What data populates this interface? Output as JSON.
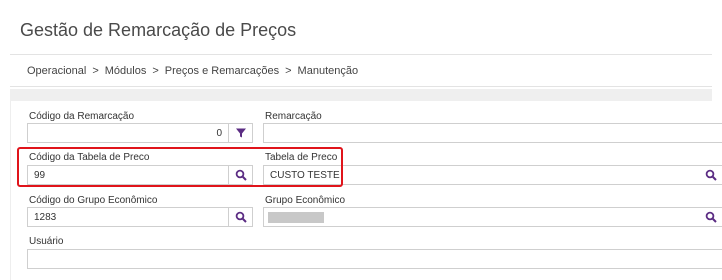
{
  "page": {
    "title": "Gestão de Remarcação de Preços"
  },
  "breadcrumb": [
    "Operacional",
    "Módulos",
    "Preços e Remarcações",
    "Manutenção"
  ],
  "breadcrumb_separator": ">",
  "form": {
    "codigo_remarcacao": {
      "label": "Código da Remarcação",
      "value": "0",
      "button_icon": "filter-icon"
    },
    "remarcacao": {
      "label": "Remarcação",
      "value": ""
    },
    "codigo_tabela_preco": {
      "label": "Código da Tabela de Preco",
      "value": "99",
      "button_icon": "search-icon"
    },
    "tabela_preco": {
      "label": "Tabela de Preco",
      "value": "CUSTO TESTE",
      "button_icon": "search-icon"
    },
    "codigo_grupo_economico": {
      "label": "Código do Grupo Econômico",
      "value": "1283",
      "button_icon": "search-icon"
    },
    "grupo_economico": {
      "label": "Grupo Econômico",
      "value": "",
      "button_icon": "search-icon"
    },
    "usuario": {
      "label": "Usuário",
      "value": ""
    }
  },
  "colors": {
    "accent": "#5b2c83",
    "highlight": "#e0141b"
  }
}
